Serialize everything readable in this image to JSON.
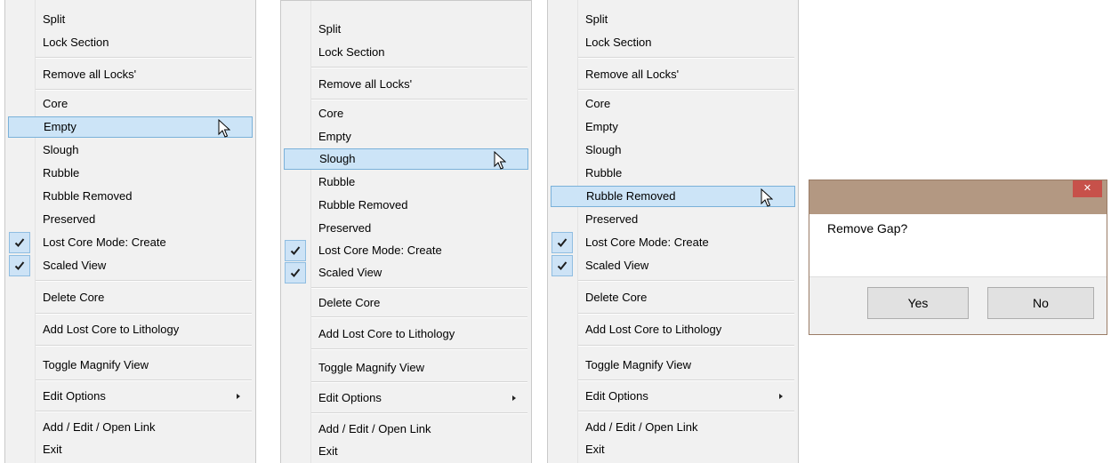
{
  "menu_items": {
    "split": "Split",
    "lock_section": "Lock Section",
    "remove_all_locks": "Remove all Locks'",
    "core": "Core",
    "empty": "Empty",
    "slough": "Slough",
    "rubble": "Rubble",
    "rubble_removed": "Rubble Removed",
    "preserved": "Preserved",
    "lost_core_mode": "Lost Core Mode: Create",
    "scaled_view": "Scaled View",
    "delete_core": "Delete Core",
    "add_lost_core": "Add Lost Core to Lithology",
    "toggle_magnify": "Toggle Magnify View",
    "edit_options": "Edit Options",
    "add_edit_open_link": "Add / Edit / Open Link",
    "exit": "Exit"
  },
  "menus": {
    "menu1": {
      "highlighted": "Empty"
    },
    "menu2": {
      "highlighted": "Slough"
    },
    "menu3": {
      "highlighted": "Rubble Removed"
    }
  },
  "checked_items": [
    "Lost Core Mode: Create",
    "Scaled View"
  ],
  "dialog": {
    "message": "Remove Gap?",
    "close_glyph": "✕",
    "yes_label": "Yes",
    "no_label": "No"
  },
  "colors": {
    "highlight_bg": "#cce4f7",
    "highlight_border": "#7ab1d9",
    "dialog_title_bar": "#b39882",
    "close_button": "#c7514a"
  }
}
